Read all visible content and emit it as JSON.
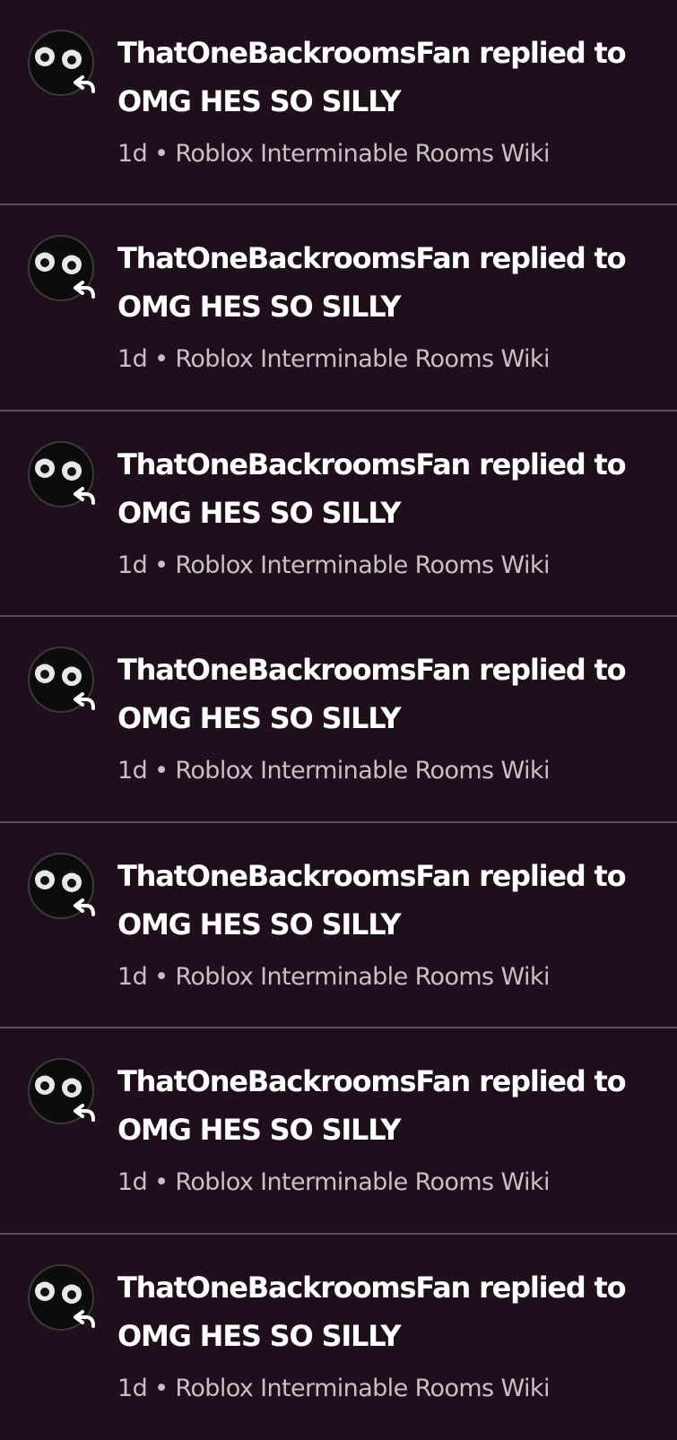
{
  "notifications": [
    {
      "user": "ThatOneBackroomsFan",
      "action": "replied to",
      "thread_title": "OMG HES SO SILLY",
      "time": "1d",
      "separator": "•",
      "wiki": "Roblox Interminable Rooms Wiki"
    },
    {
      "user": "ThatOneBackroomsFan",
      "action": "replied to",
      "thread_title": "OMG HES SO SILLY",
      "time": "1d",
      "separator": "•",
      "wiki": "Roblox Interminable Rooms Wiki"
    },
    {
      "user": "ThatOneBackroomsFan",
      "action": "replied to",
      "thread_title": "OMG HES SO SILLY",
      "time": "1d",
      "separator": "•",
      "wiki": "Roblox Interminable Rooms Wiki"
    },
    {
      "user": "ThatOneBackroomsFan",
      "action": "replied to",
      "thread_title": "OMG HES SO SILLY",
      "time": "1d",
      "separator": "•",
      "wiki": "Roblox Interminable Rooms Wiki"
    },
    {
      "user": "ThatOneBackroomsFan",
      "action": "replied to",
      "thread_title": "OMG HES SO SILLY",
      "time": "1d",
      "separator": "•",
      "wiki": "Roblox Interminable Rooms Wiki"
    },
    {
      "user": "ThatOneBackroomsFan",
      "action": "replied to",
      "thread_title": "OMG HES SO SILLY",
      "time": "1d",
      "separator": "•",
      "wiki": "Roblox Interminable Rooms Wiki"
    },
    {
      "user": "ThatOneBackroomsFan",
      "action": "replied to",
      "thread_title": "OMG HES SO SILLY",
      "time": "1d",
      "separator": "•",
      "wiki": "Roblox Interminable Rooms Wiki"
    }
  ],
  "icons": {
    "avatar": "avatar-face-icon",
    "reply": "reply-arrow-icon"
  },
  "colors": {
    "background": "#1f0f1c",
    "divider": "#5c4d5a",
    "primary_text": "#ffffff",
    "secondary_text": "#c9bfc7"
  }
}
